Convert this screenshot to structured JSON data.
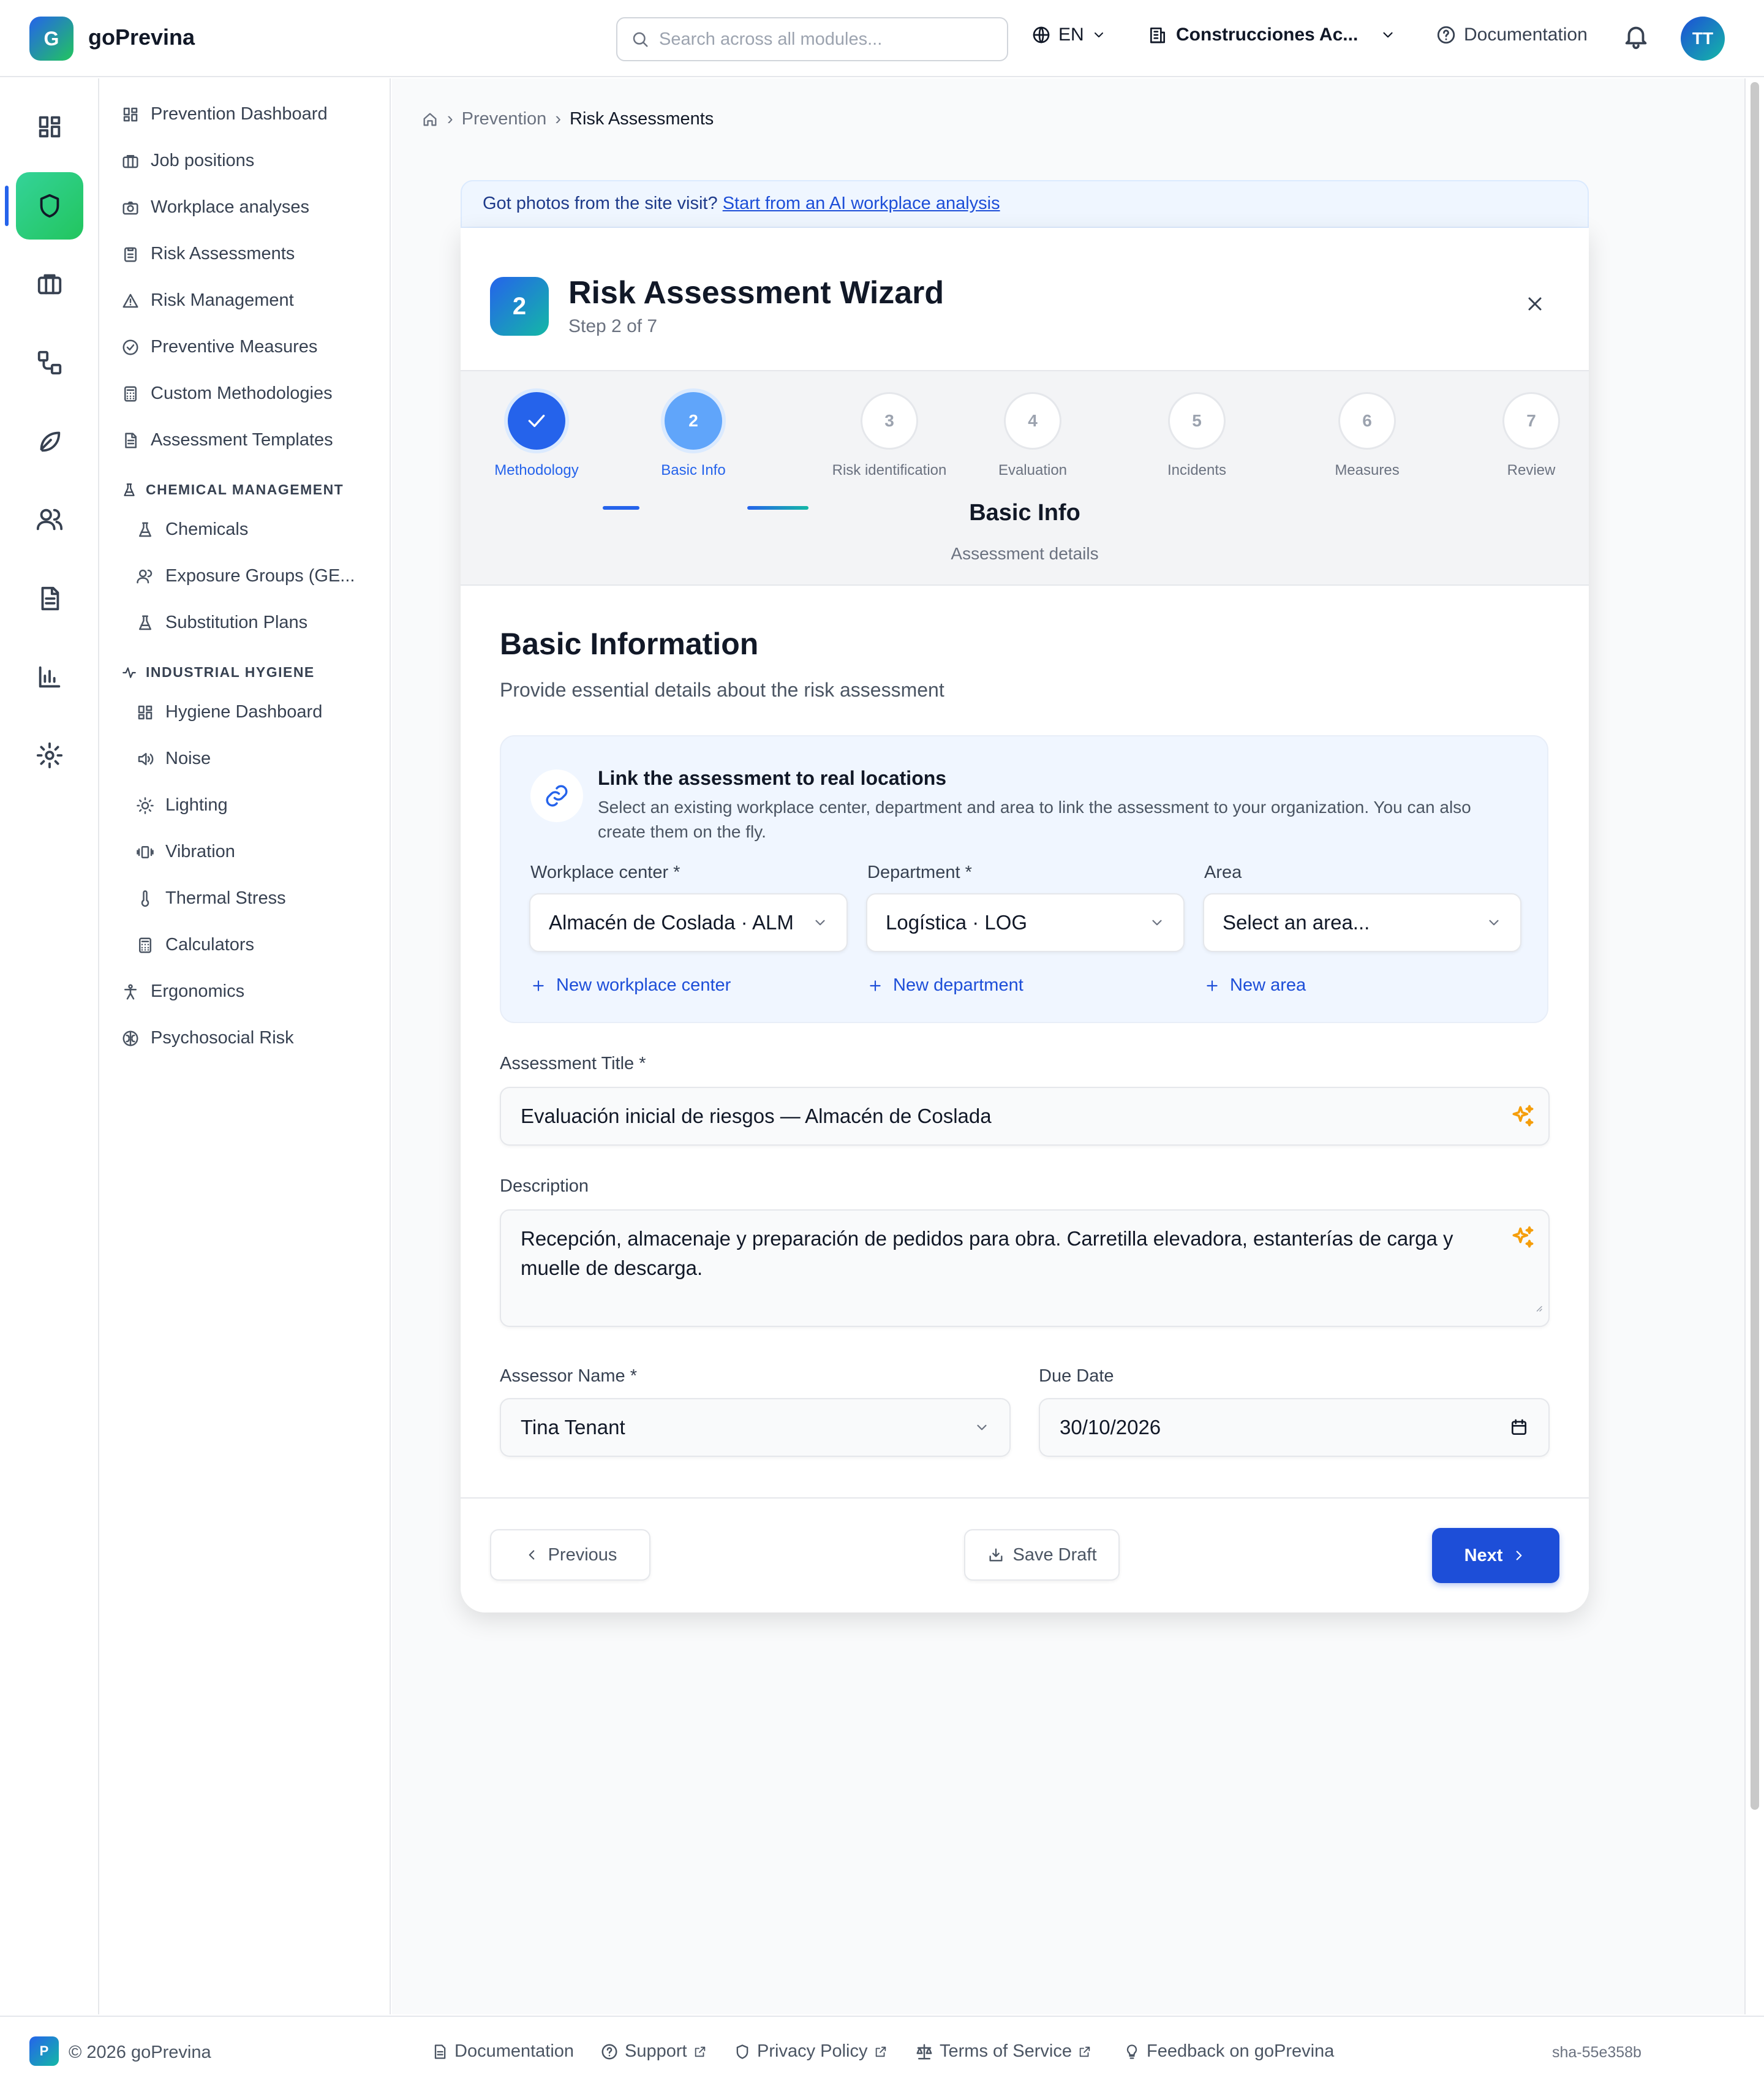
{
  "app": {
    "logo_letter": "G",
    "name": "goPrevina"
  },
  "header": {
    "search_placeholder": "Search across all modules...",
    "language": "EN",
    "organization": "Construcciones Ac...",
    "documentation": "Documentation",
    "user_initials": "TT"
  },
  "sidebar": {
    "items": [
      {
        "label": "Prevention Dashboard",
        "icon": "dashboard-icon"
      },
      {
        "label": "Job positions",
        "icon": "briefcase-icon"
      },
      {
        "label": "Workplace analyses",
        "icon": "camera-icon"
      },
      {
        "label": "Risk Assessments",
        "icon": "clipboard-icon"
      },
      {
        "label": "Risk Management",
        "icon": "warning-icon"
      },
      {
        "label": "Preventive Measures",
        "icon": "check-circle-icon"
      },
      {
        "label": "Custom Methodologies",
        "icon": "calculator-icon"
      },
      {
        "label": "Assessment Templates",
        "icon": "document-icon"
      }
    ],
    "chemical_heading": "CHEMICAL MANAGEMENT",
    "chemical_items": [
      {
        "label": "Chemicals",
        "icon": "flask-icon"
      },
      {
        "label": "Exposure Groups (GE...",
        "icon": "users-icon"
      },
      {
        "label": "Substitution Plans",
        "icon": "flask-icon"
      }
    ],
    "hygiene_heading": "INDUSTRIAL HYGIENE",
    "hygiene_items": [
      {
        "label": "Hygiene Dashboard",
        "icon": "dashboard-icon"
      },
      {
        "label": "Noise",
        "icon": "speaker-icon"
      },
      {
        "label": "Lighting",
        "icon": "sun-icon"
      },
      {
        "label": "Vibration",
        "icon": "vibration-icon"
      },
      {
        "label": "Thermal Stress",
        "icon": "thermometer-icon"
      },
      {
        "label": "Calculators",
        "icon": "calculator-icon"
      }
    ],
    "bottom_items": [
      {
        "label": "Ergonomics",
        "icon": "person-icon"
      },
      {
        "label": "Psychosocial Risk",
        "icon": "brain-icon"
      }
    ]
  },
  "breadcrumb": {
    "parent": "Prevention",
    "current": "Risk Assessments"
  },
  "banner": {
    "text": "Got photos from the site visit?",
    "link": "Start from an AI workplace analysis"
  },
  "wizard": {
    "badge": "2",
    "title": "Risk Assessment Wizard",
    "subtitle": "Step 2 of 7",
    "steps": [
      {
        "number": "1",
        "label": "Methodology",
        "state": "done"
      },
      {
        "number": "2",
        "label": "Basic Info",
        "state": "current"
      },
      {
        "number": "3",
        "label": "Risk identification",
        "state": "todo"
      },
      {
        "number": "4",
        "label": "Evaluation",
        "state": "todo"
      },
      {
        "number": "5",
        "label": "Incidents",
        "state": "todo"
      },
      {
        "number": "6",
        "label": "Measures",
        "state": "todo"
      },
      {
        "number": "7",
        "label": "Review",
        "state": "todo"
      }
    ],
    "current_step_name": "Basic Info",
    "current_step_desc": "Assessment details"
  },
  "form": {
    "title": "Basic Information",
    "subtitle": "Provide essential details about the risk assessment",
    "link_box": {
      "title": "Link the assessment to real locations",
      "description": "Select an existing workplace center, department and area to link the assessment to your organization. You can also create them on the fly.",
      "workplace_label": "Workplace center *",
      "workplace_value": "Almacén de Coslada · ALM",
      "workplace_new": "New workplace center",
      "department_label": "Department *",
      "department_value": "Logística · LOG",
      "department_new": "New department",
      "area_label": "Area",
      "area_value": "Select an area...",
      "area_new": "New area"
    },
    "title_label": "Assessment Title *",
    "title_value": "Evaluación inicial de riesgos — Almacén de Coslada",
    "description_label": "Description",
    "description_value": "Recepción, almacenaje y preparación de pedidos para obra. Carretilla elevadora, estanterías de carga y muelle de descarga.",
    "assessor_label": "Assessor Name *",
    "assessor_value": "Tina Tenant",
    "due_label": "Due Date",
    "due_value": "30/10/2026"
  },
  "actions": {
    "previous": "Previous",
    "save_draft": "Save Draft",
    "next": "Next"
  },
  "footer": {
    "logo_letter": "P",
    "copyright": "© 2026 goPrevina",
    "documentation": "Documentation",
    "support": "Support",
    "privacy": "Privacy Policy",
    "terms": "Terms of Service",
    "feedback": "Feedback on goPrevina",
    "sha": "sha-55e358b"
  },
  "colors": {
    "primary": "#1d4ed8",
    "accent_green": "#22c55e",
    "sparkle": "#f59e0b"
  }
}
